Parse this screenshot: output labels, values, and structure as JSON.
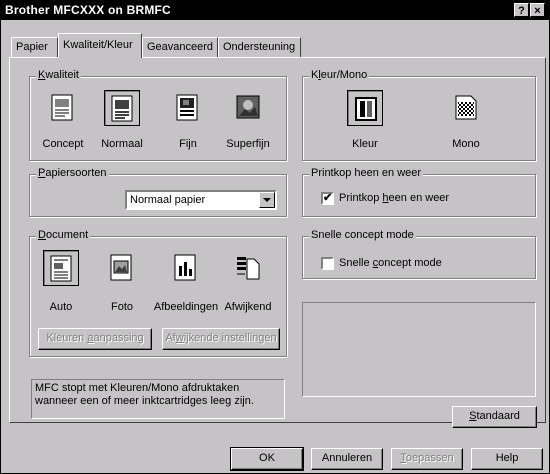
{
  "window": {
    "title": "Brother MFCXXX on BRMFC",
    "help_btn": "?",
    "close_btn": "×"
  },
  "tabs": [
    "Papier",
    "Kwaliteit/Kleur",
    "Geavanceerd",
    "Ondersteuning"
  ],
  "quality": {
    "legend": "Kwaliteit",
    "items": [
      {
        "label": "Concept"
      },
      {
        "label": "Normaal"
      },
      {
        "label": "Fijn"
      },
      {
        "label": "Superfijn"
      }
    ],
    "selected": "Normaal"
  },
  "color_mono": {
    "legend": "Kleur/Mono",
    "items": [
      {
        "label": "Kleur"
      },
      {
        "label": "Mono"
      }
    ],
    "selected": "Kleur"
  },
  "paper_types": {
    "legend": "Papiersoorten",
    "value": "Normaal papier"
  },
  "print_head": {
    "legend": "Printkop heen en weer",
    "checkbox_label": "Printkop heen en weer",
    "checked": true
  },
  "document": {
    "legend": "Document",
    "items": [
      {
        "label": "Auto"
      },
      {
        "label": "Foto"
      },
      {
        "label": "Afbeeldingen"
      },
      {
        "label": "Afwijkend"
      }
    ],
    "selected": "Auto",
    "color_adjust_button": "Kleuren aanpassing",
    "custom_settings_button": "Afwijkende instellingen"
  },
  "quick_draft": {
    "legend": "Snelle concept mode",
    "checkbox_label": "Snelle concept mode",
    "checked": false
  },
  "info_text": "MFC stopt met Kleuren/Mono afdruktaken wanneer een of meer inktcartridges leeg zijn.",
  "buttons": {
    "standard": "Standaard",
    "ok": "OK",
    "cancel": "Annuleren",
    "apply": "Toepassen",
    "help": "Help"
  }
}
